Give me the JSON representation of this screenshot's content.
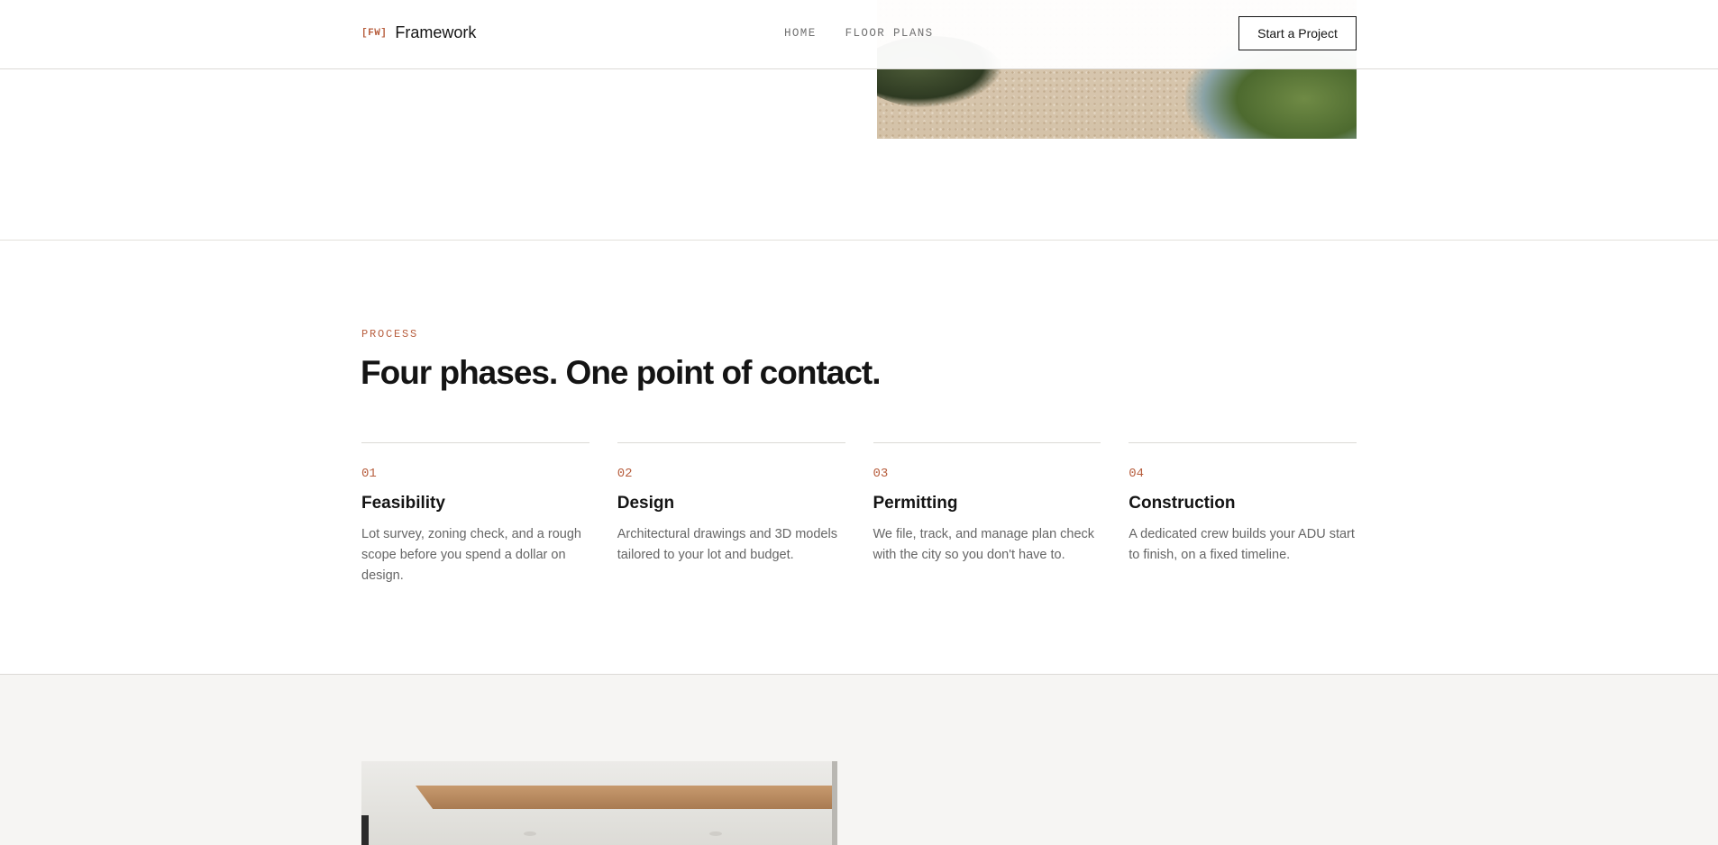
{
  "header": {
    "brand_mark": "[FW]",
    "brand_name": "Framework",
    "nav": [
      "HOME",
      "FLOOR PLANS"
    ],
    "cta_label": "Start a Project"
  },
  "process": {
    "eyebrow": "PROCESS",
    "headline": "Four phases. One point of contact.",
    "phases": [
      {
        "number": "01",
        "title": "Feasibility",
        "description": "Lot survey, zoning check, and a rough scope before you spend a dollar on design."
      },
      {
        "number": "02",
        "title": "Design",
        "description": "Architectural drawings and 3D models tailored to your lot and budget."
      },
      {
        "number": "03",
        "title": "Permitting",
        "description": "We file, track, and manage plan check with the city so you don't have to."
      },
      {
        "number": "04",
        "title": "Construction",
        "description": "A dedicated crew builds your ADU start to finish, on a fixed timeline."
      }
    ]
  },
  "colors": {
    "accent": "#b85f3f",
    "text": "#141414",
    "muted": "#666666",
    "gallery_bg": "#f6f5f3"
  }
}
